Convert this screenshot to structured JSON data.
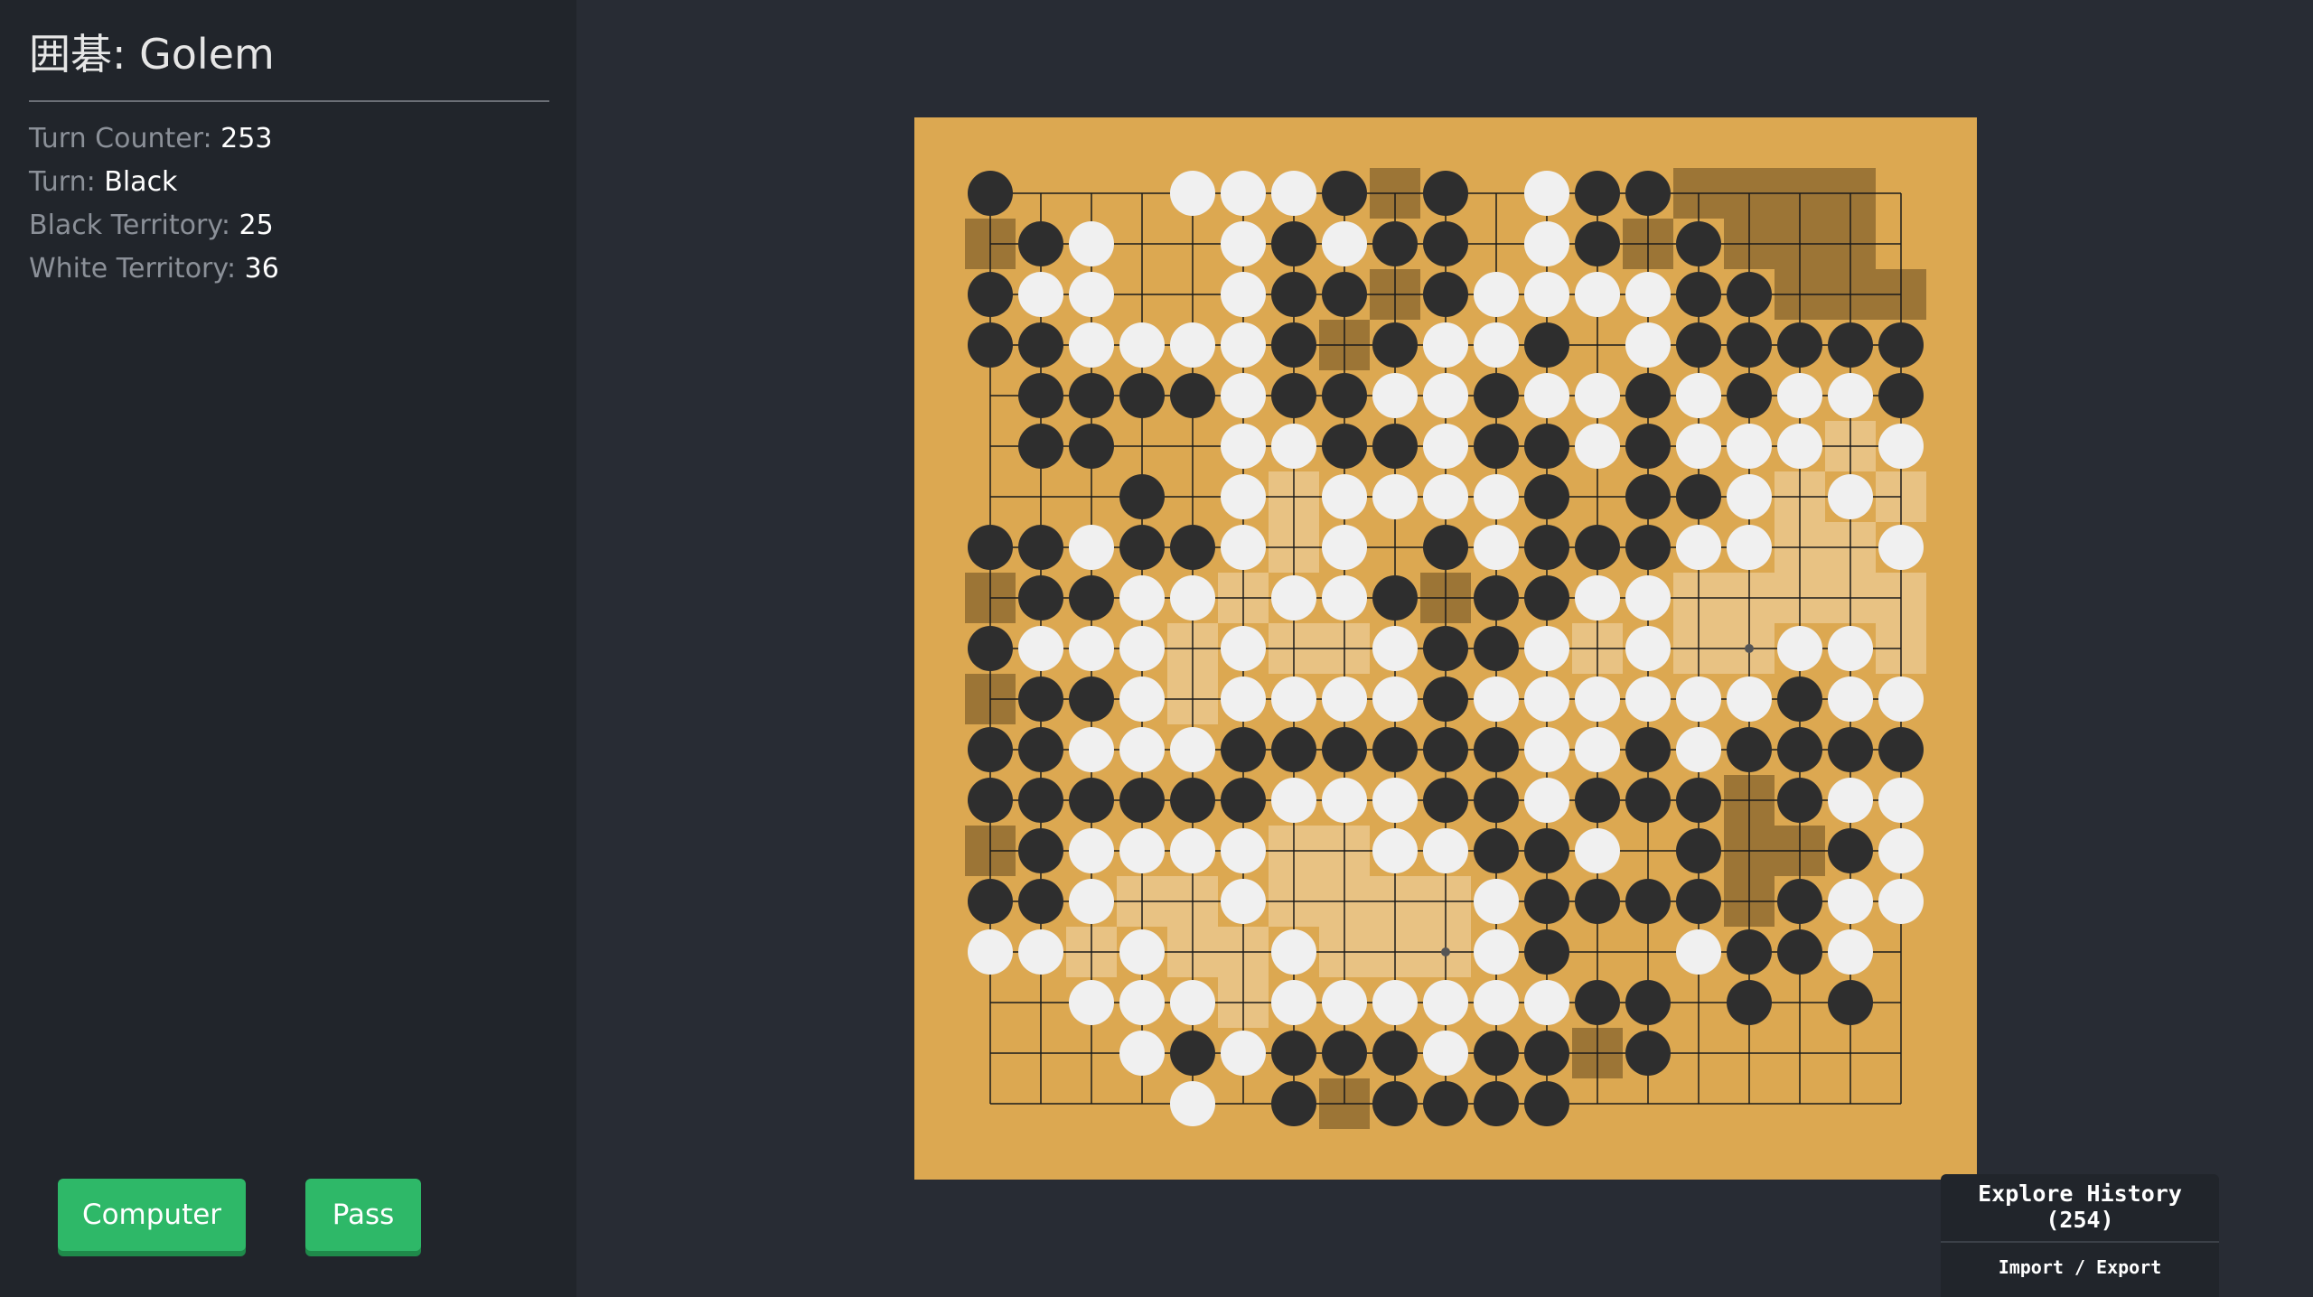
{
  "sidebar": {
    "title": "囲碁: Golem",
    "stats": {
      "turn_counter_label": "Turn Counter:",
      "turn_counter_value": "253",
      "turn_label": "Turn:",
      "turn_value": "Black",
      "black_territory_label": "Black Territory:",
      "black_territory_value": "25",
      "white_territory_label": "White Territory:",
      "white_territory_value": "36"
    },
    "buttons": {
      "computer": "Computer",
      "pass": "Pass"
    }
  },
  "history": {
    "explore_label": "Explore History (254)",
    "import_export_label": "Import / Export"
  },
  "colors": {
    "board": "#dca851",
    "black_stone": "#2e2e2e",
    "white_stone": "#f0f0f0",
    "black_territory": "#9c7536",
    "white_territory": "#e8c283",
    "button": "#2eb868"
  },
  "board": {
    "size": 19,
    "legend": "B = black stone, W = white stone, b = black territory, w = white territory, . = empty",
    "rows": [
      "B...WWWBbB.WBBbbbb.",
      "bBW..WBWBB.WBbBbbb.",
      "BWW..WBBbBWWWWBBbbb",
      "BBWWWWBbBWWB.WBBBBB",
      ".BBBBWBBWWBWWBWBWWB",
      ".BB..WWBBWBBWBWWWwW",
      "...B.WwWWWWB.BBWwWw",
      "BBWBBWwW.BWBBBWWwwW",
      "bBBWWwWWBbBBWWwwwww",
      "BWWWwWwwWBBWwWwwWWw",
      "bBBWwWWWWBWWWWWWBWW",
      "BBWWWBBBBBBWWBWBBBB",
      "BBBBBBWWWBBWBBBbBWW",
      "bBWWWWwwWWBBW.BbbBW",
      "BBWwwWwwwwWBBBBbBWW",
      "WWwWwwWwwwWB..WBBW.",
      "..WWWwWWWWWWBB.B.B.",
      "...WBWBBBWBBbB.....",
      "....W.BbBBBB......."
    ]
  }
}
